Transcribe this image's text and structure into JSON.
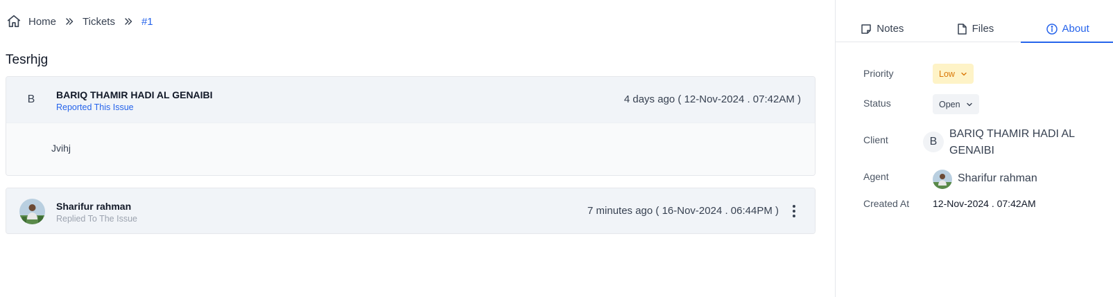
{
  "breadcrumb": {
    "home": "Home",
    "tickets": "Tickets",
    "current": "#1"
  },
  "ticket": {
    "title": "Tesrhjg"
  },
  "messages": [
    {
      "avatar_letter": "B",
      "name": "BARIQ THAMIR HADI AL GENAIBI",
      "role": "Reported This Issue",
      "time": "4 days ago ( 12-Nov-2024 . 07:42AM )",
      "body": "Jvihj"
    },
    {
      "name": "Sharifur rahman",
      "role": "Replied To The Issue",
      "time": "7 minutes ago ( 16-Nov-2024 . 06:44PM )"
    }
  ],
  "side": {
    "tabs": [
      {
        "label": "Notes",
        "icon": "note-icon"
      },
      {
        "label": "Files",
        "icon": "file-icon"
      },
      {
        "label": "About",
        "icon": "info-icon",
        "active": true
      }
    ],
    "labels": {
      "priority": "Priority",
      "status": "Status",
      "client": "Client",
      "agent": "Agent",
      "created_at": "Created At"
    },
    "priority": "Low",
    "status": "Open",
    "client_letter": "B",
    "client": "BARIQ THAMIR HADI AL GENAIBI",
    "agent": "Sharifur rahman",
    "created_at": "12-Nov-2024 . 07:42AM"
  },
  "colors": {
    "accent": "#2563eb",
    "priority_low_bg": "#fef3c7",
    "priority_low_text": "#d97706"
  }
}
